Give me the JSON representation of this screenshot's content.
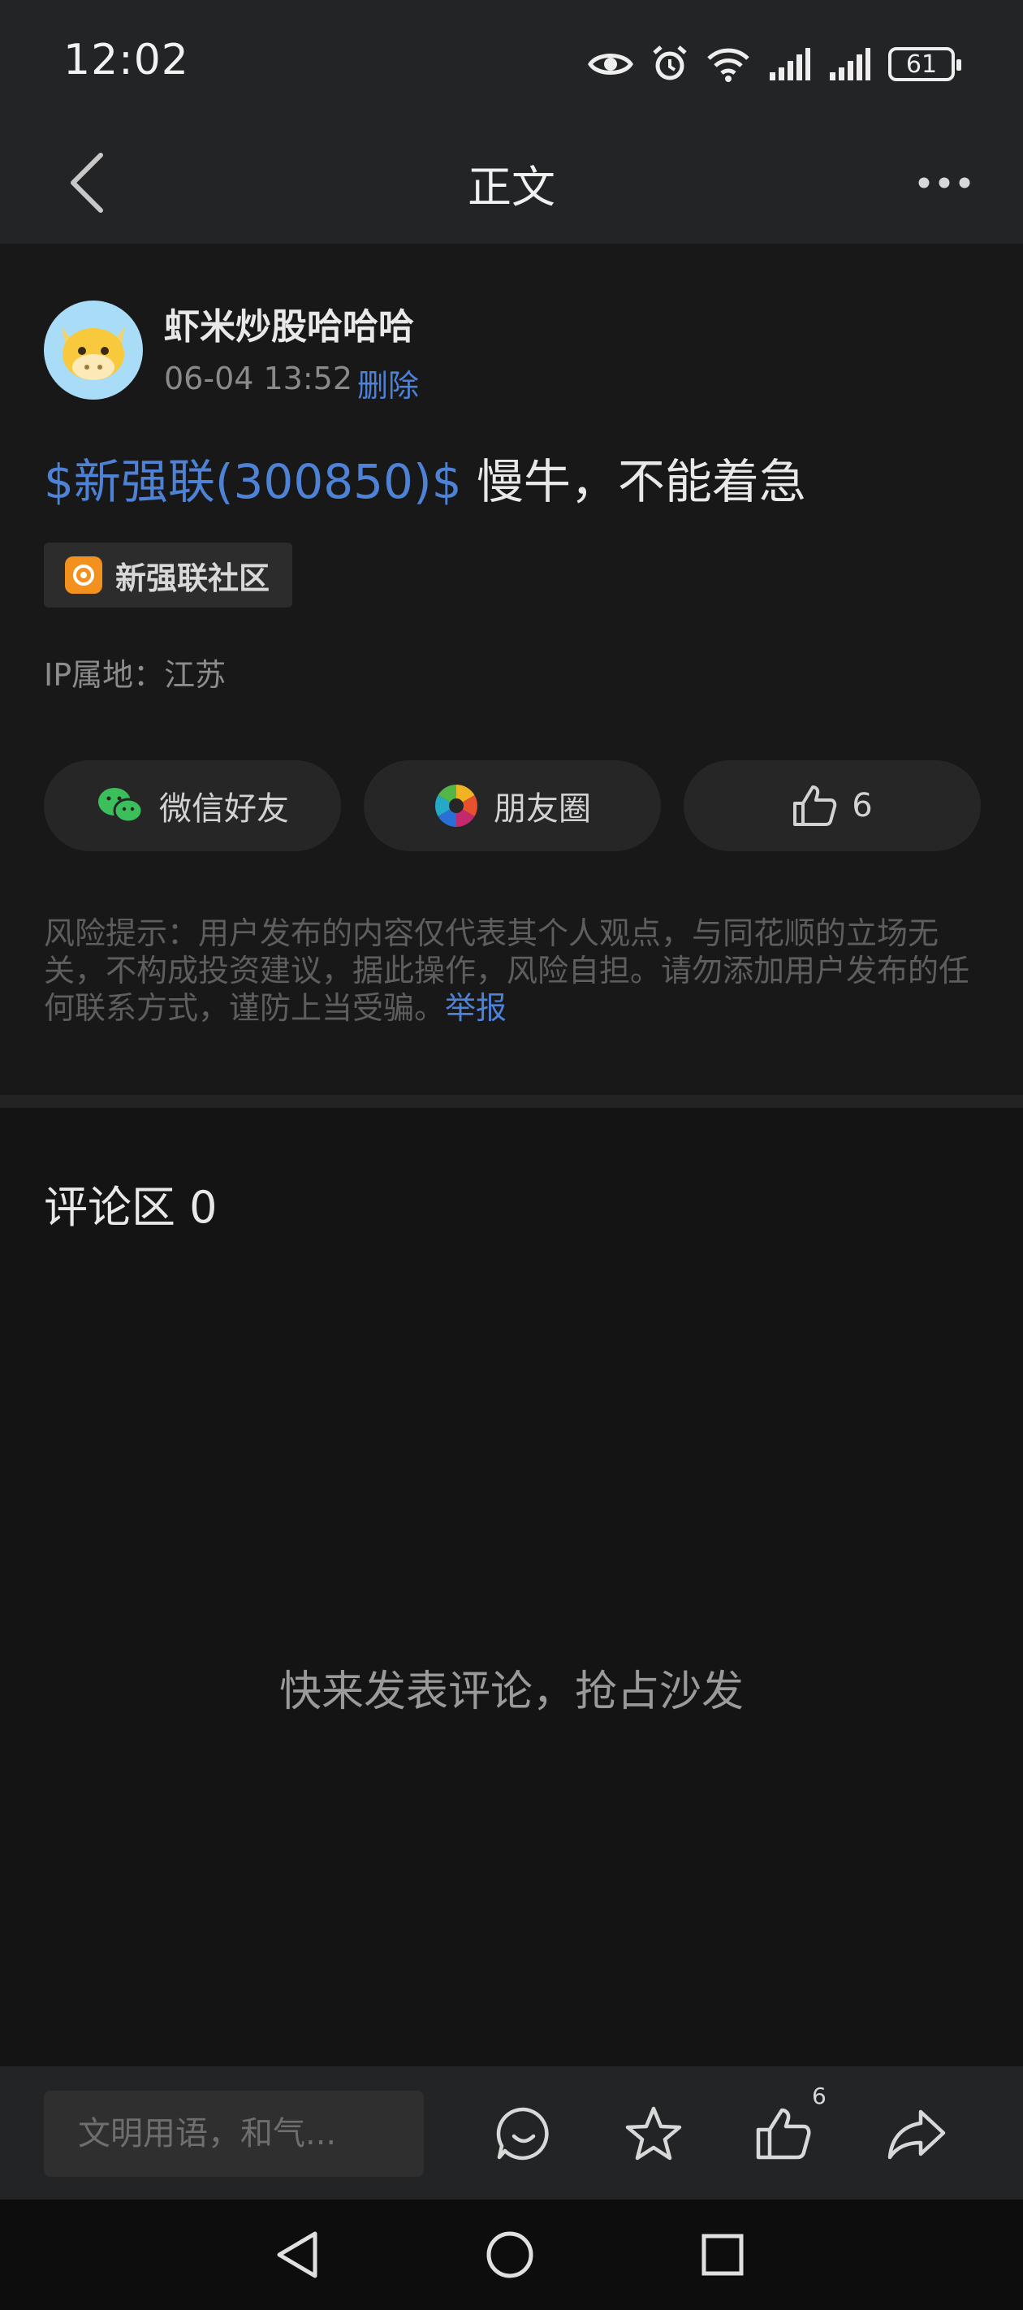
{
  "status_bar": {
    "time": "12:02",
    "battery": "61"
  },
  "nav": {
    "title": "正文"
  },
  "post": {
    "author": "虾米炒股哈哈哈",
    "time": "06-04 13:52",
    "delete_label": "删除",
    "stock_link": "$新强联(300850)$",
    "content": " 慢牛，不能着急",
    "community": "新强联社区",
    "ip_location": "IP属地：江苏",
    "share_wechat": "微信好友",
    "share_moments": "朋友圈",
    "like_count": "6",
    "risk_notice": "风险提示：用户发布的内容仅代表其个人观点，与同花顺的立场无关，不构成投资建议，据此操作，风险自担。请勿添加用户发布的任何联系方式，谨防上当受骗。",
    "report_label": "举报"
  },
  "comments": {
    "title": "评论区 0",
    "empty_text": "快来发表评论，抢占沙发"
  },
  "action_bar": {
    "input_placeholder": "文明用语，和气...",
    "like_count": "6"
  }
}
